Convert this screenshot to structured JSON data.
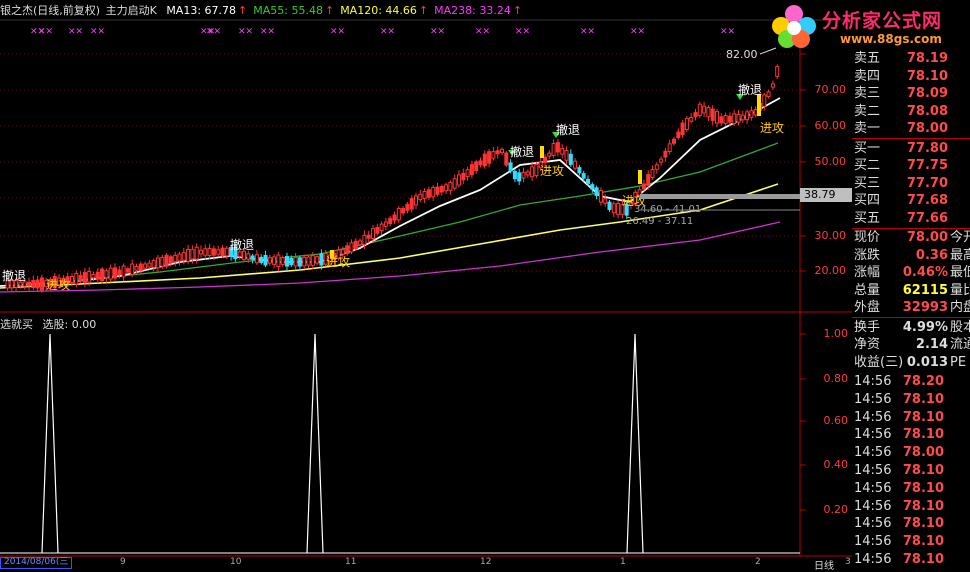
{
  "header": {
    "stock_name": "银之杰(日线,前复权)",
    "indicator_name": "主力启动K",
    "ma": [
      {
        "label": "MA13: 67.78",
        "color": "#ffffff"
      },
      {
        "label": "MA55: 55.48",
        "color": "#33cc33"
      },
      {
        "label": "MA120: 44.66",
        "color": "#ffff33"
      },
      {
        "label": "MA238: 33.24",
        "color": "#ff33ff"
      }
    ],
    "arrow": "↑"
  },
  "sub_header": {
    "name": "选就买",
    "pick_label": "选股: 0.00"
  },
  "logo": {
    "title": "分析家公式网",
    "url": "www.88gs.com"
  },
  "main_axis": [
    "70.00",
    "60.00",
    "50.00",
    "40.00",
    "30.00",
    "20.00"
  ],
  "sub_axis": [
    "1.00",
    "0.80",
    "0.60",
    "0.40",
    "0.20"
  ],
  "price_tag": "38.79",
  "annotations": {
    "retreat": "撤退",
    "attack": "进攻",
    "high_label": "82.00",
    "range1": "34.60 - 41.01",
    "range2": "26.49 - 37.11"
  },
  "date_box": "2014/08/06(三",
  "date_marks": [
    "9",
    "10",
    "11",
    "12",
    "1",
    "2",
    "3"
  ],
  "bottom_right": "日线",
  "order_book": [
    {
      "label": "卖五",
      "price": "78.19",
      "color": "#ff4b4b"
    },
    {
      "label": "卖四",
      "price": "78.10",
      "color": "#ff4b4b"
    },
    {
      "label": "卖三",
      "price": "78.09",
      "color": "#ff4b4b"
    },
    {
      "label": "卖二",
      "price": "78.08",
      "color": "#ff4b4b"
    },
    {
      "label": "卖一",
      "price": "78.00",
      "color": "#ff4b4b"
    },
    {
      "label": "买一",
      "price": "77.80",
      "color": "#ff4b4b"
    },
    {
      "label": "买二",
      "price": "77.75",
      "color": "#ff4b4b"
    },
    {
      "label": "买三",
      "price": "77.70",
      "color": "#ff4b4b"
    },
    {
      "label": "买四",
      "price": "77.68",
      "color": "#ff4b4b"
    },
    {
      "label": "买五",
      "price": "77.66",
      "color": "#ff4b4b"
    }
  ],
  "quote": [
    {
      "label": "现价",
      "value": "78.00",
      "color": "#ff4b4b",
      "extra": "今开"
    },
    {
      "label": "涨跌",
      "value": "0.36",
      "color": "#ff4b4b",
      "extra": "最高"
    },
    {
      "label": "涨幅",
      "value": "0.46%",
      "color": "#ff4b4b",
      "extra": "最低"
    },
    {
      "label": "总量",
      "value": "62115",
      "color": "#ffff33",
      "extra": "量比"
    },
    {
      "label": "外盘",
      "value": "32993",
      "color": "#ff4b4b",
      "extra": "内盘"
    }
  ],
  "fundamentals": [
    {
      "label": "换手",
      "value": "4.99%",
      "color": "#dddddd",
      "extra": "股本"
    },
    {
      "label": "净资",
      "value": "2.14",
      "color": "#dddddd",
      "extra": "流通"
    },
    {
      "label": "收益(三)",
      "value": "0.013",
      "color": "#dddddd",
      "extra": "PE"
    }
  ],
  "ticks": [
    {
      "time": "14:56",
      "price": "78.20"
    },
    {
      "time": "14:56",
      "price": "78.10"
    },
    {
      "time": "14:56",
      "price": "78.10"
    },
    {
      "time": "14:56",
      "price": "78.10"
    },
    {
      "time": "14:56",
      "price": "78.00"
    },
    {
      "time": "14:56",
      "price": "78.10"
    },
    {
      "time": "14:56",
      "price": "78.10"
    },
    {
      "time": "14:56",
      "price": "78.10"
    },
    {
      "time": "14:56",
      "price": "78.10"
    },
    {
      "time": "14:56",
      "price": "78.10"
    },
    {
      "time": "14:56",
      "price": "78.10"
    }
  ]
}
